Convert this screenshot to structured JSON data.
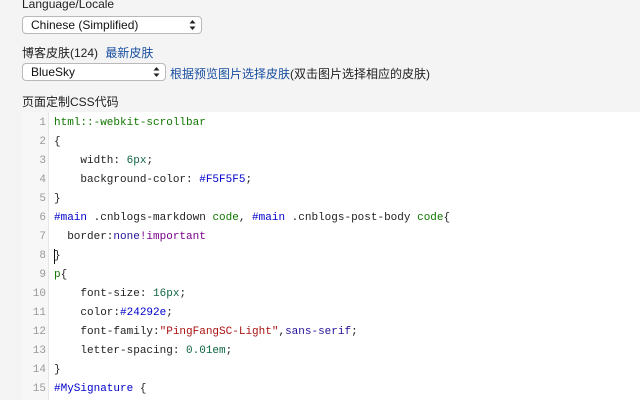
{
  "language": {
    "label": "Language/Locale",
    "selected": "Chinese (Simplified)"
  },
  "skin": {
    "label": "博客皮肤(124)",
    "latest_link": "最新皮肤",
    "selected": "BlueSky",
    "preview_link": "根据预览图片选择皮肤",
    "preview_note": "(双击图片选择相应的皮肤)"
  },
  "css_editor": {
    "label": "页面定制CSS代码",
    "lines": [
      {
        "n": "1",
        "tokens": [
          {
            "t": "html::-webkit-scrollbar",
            "c": "tag"
          }
        ]
      },
      {
        "n": "2",
        "tokens": [
          {
            "t": "{",
            "c": "plain"
          }
        ]
      },
      {
        "n": "3",
        "tokens": [
          {
            "t": "    width: ",
            "c": "property"
          },
          {
            "t": "6px",
            "c": "number"
          },
          {
            "t": ";",
            "c": "plain"
          }
        ]
      },
      {
        "n": "4",
        "tokens": [
          {
            "t": "    background-color: ",
            "c": "property"
          },
          {
            "t": "#F5F5F5",
            "c": "hex"
          },
          {
            "t": ";",
            "c": "plain"
          }
        ]
      },
      {
        "n": "5",
        "tokens": [
          {
            "t": "}",
            "c": "plain"
          }
        ]
      },
      {
        "n": "6",
        "tokens": [
          {
            "t": "#main",
            "c": "hex"
          },
          {
            "t": " .cnblogs-markdown ",
            "c": "plain"
          },
          {
            "t": "code",
            "c": "tag"
          },
          {
            "t": ", ",
            "c": "plain"
          },
          {
            "t": "#main",
            "c": "hex"
          },
          {
            "t": " .cnblogs-post-body ",
            "c": "plain"
          },
          {
            "t": "code",
            "c": "tag"
          },
          {
            "t": "{",
            "c": "plain"
          }
        ]
      },
      {
        "n": "7",
        "tokens": [
          {
            "t": "  border:",
            "c": "property"
          },
          {
            "t": "none",
            "c": "atom"
          },
          {
            "t": "!important",
            "c": "keyword"
          }
        ]
      },
      {
        "n": "8",
        "tokens": [
          {
            "t": "}",
            "c": "plain"
          }
        ]
      },
      {
        "n": "9",
        "tokens": [
          {
            "t": "p",
            "c": "tag"
          },
          {
            "t": "{",
            "c": "plain"
          }
        ]
      },
      {
        "n": "10",
        "tokens": [
          {
            "t": "    font-size: ",
            "c": "property"
          },
          {
            "t": "16px",
            "c": "number"
          },
          {
            "t": ";",
            "c": "plain"
          }
        ]
      },
      {
        "n": "11",
        "tokens": [
          {
            "t": "    color:",
            "c": "property"
          },
          {
            "t": "#24292e",
            "c": "hex"
          },
          {
            "t": ";",
            "c": "plain"
          }
        ]
      },
      {
        "n": "12",
        "tokens": [
          {
            "t": "    font-family:",
            "c": "property"
          },
          {
            "t": "\"PingFangSC-Light\"",
            "c": "string"
          },
          {
            "t": ",",
            "c": "plain"
          },
          {
            "t": "sans-serif",
            "c": "atom"
          },
          {
            "t": ";",
            "c": "plain"
          }
        ]
      },
      {
        "n": "13",
        "tokens": [
          {
            "t": "    letter-spacing: ",
            "c": "property"
          },
          {
            "t": "0.01em",
            "c": "number"
          },
          {
            "t": ";",
            "c": "plain"
          }
        ]
      },
      {
        "n": "14",
        "tokens": [
          {
            "t": "}",
            "c": "plain"
          }
        ]
      },
      {
        "n": "15",
        "tokens": [
          {
            "t": "#MySignature",
            "c": "hex"
          },
          {
            "t": " {",
            "c": "plain"
          }
        ]
      }
    ]
  }
}
